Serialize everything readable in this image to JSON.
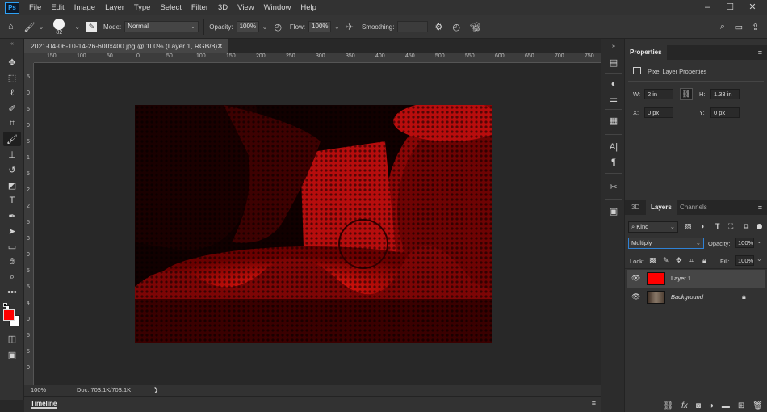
{
  "app": {
    "logo": "Ps",
    "menu": [
      "File",
      "Edit",
      "Image",
      "Layer",
      "Type",
      "Select",
      "Filter",
      "3D",
      "View",
      "Window",
      "Help"
    ],
    "window_controls": [
      "–",
      "☐",
      "✕"
    ]
  },
  "options_bar": {
    "brush_size": "82",
    "mode_label": "Mode:",
    "mode_value": "Normal",
    "opacity_label": "Opacity:",
    "opacity_value": "100%",
    "flow_label": "Flow:",
    "flow_value": "100%",
    "smoothing_label": "Smoothing:",
    "smoothing_value": ""
  },
  "document": {
    "tab_title": "2021-04-06-10-14-26-600x400.jpg @ 100% (Layer 1, RGB/8) *",
    "tab_close": "✕",
    "ruler_h": [
      "150",
      "100",
      "50",
      "0",
      "50",
      "100",
      "150",
      "200",
      "250",
      "300",
      "350",
      "400",
      "450",
      "500",
      "550",
      "600",
      "650",
      "700",
      "750"
    ],
    "ruler_v": [
      "5",
      "0",
      "5",
      "0",
      "5",
      "1",
      "5",
      "2",
      "2",
      "5",
      "3",
      "0",
      "5",
      "5",
      "4",
      "0",
      "5",
      "5",
      "0"
    ],
    "zoom": "100%",
    "doc_info": "Doc: 703.1K/703.1K",
    "doc_info_arrow": "❯"
  },
  "timeline": {
    "label": "Timeline"
  },
  "properties": {
    "tab": "Properties",
    "title": "Pixel Layer Properties",
    "w_label": "W:",
    "w_value": "2 in",
    "h_label": "H:",
    "h_value": "1.33 in",
    "x_label": "X:",
    "x_value": "0 px",
    "y_label": "Y:",
    "y_value": "0 px"
  },
  "layers_panel": {
    "tabs": [
      "3D",
      "Layers",
      "Channels"
    ],
    "active_tab": "Layers",
    "filter_kind": "Kind",
    "blend_mode": "Multiply",
    "opacity_label": "Opacity:",
    "opacity_value": "100%",
    "lock_label": "Lock:",
    "fill_label": "Fill:",
    "fill_value": "100%",
    "layers": [
      {
        "name": "Layer 1",
        "selected": true,
        "thumb_color": "#ff0000"
      },
      {
        "name": "Background",
        "selected": false,
        "locked": true,
        "thumb_color": "#6a5a4e"
      }
    ]
  },
  "colors": {
    "foreground": "#ff0000",
    "background": "#ffffff",
    "accent": "#2fa3f7"
  }
}
